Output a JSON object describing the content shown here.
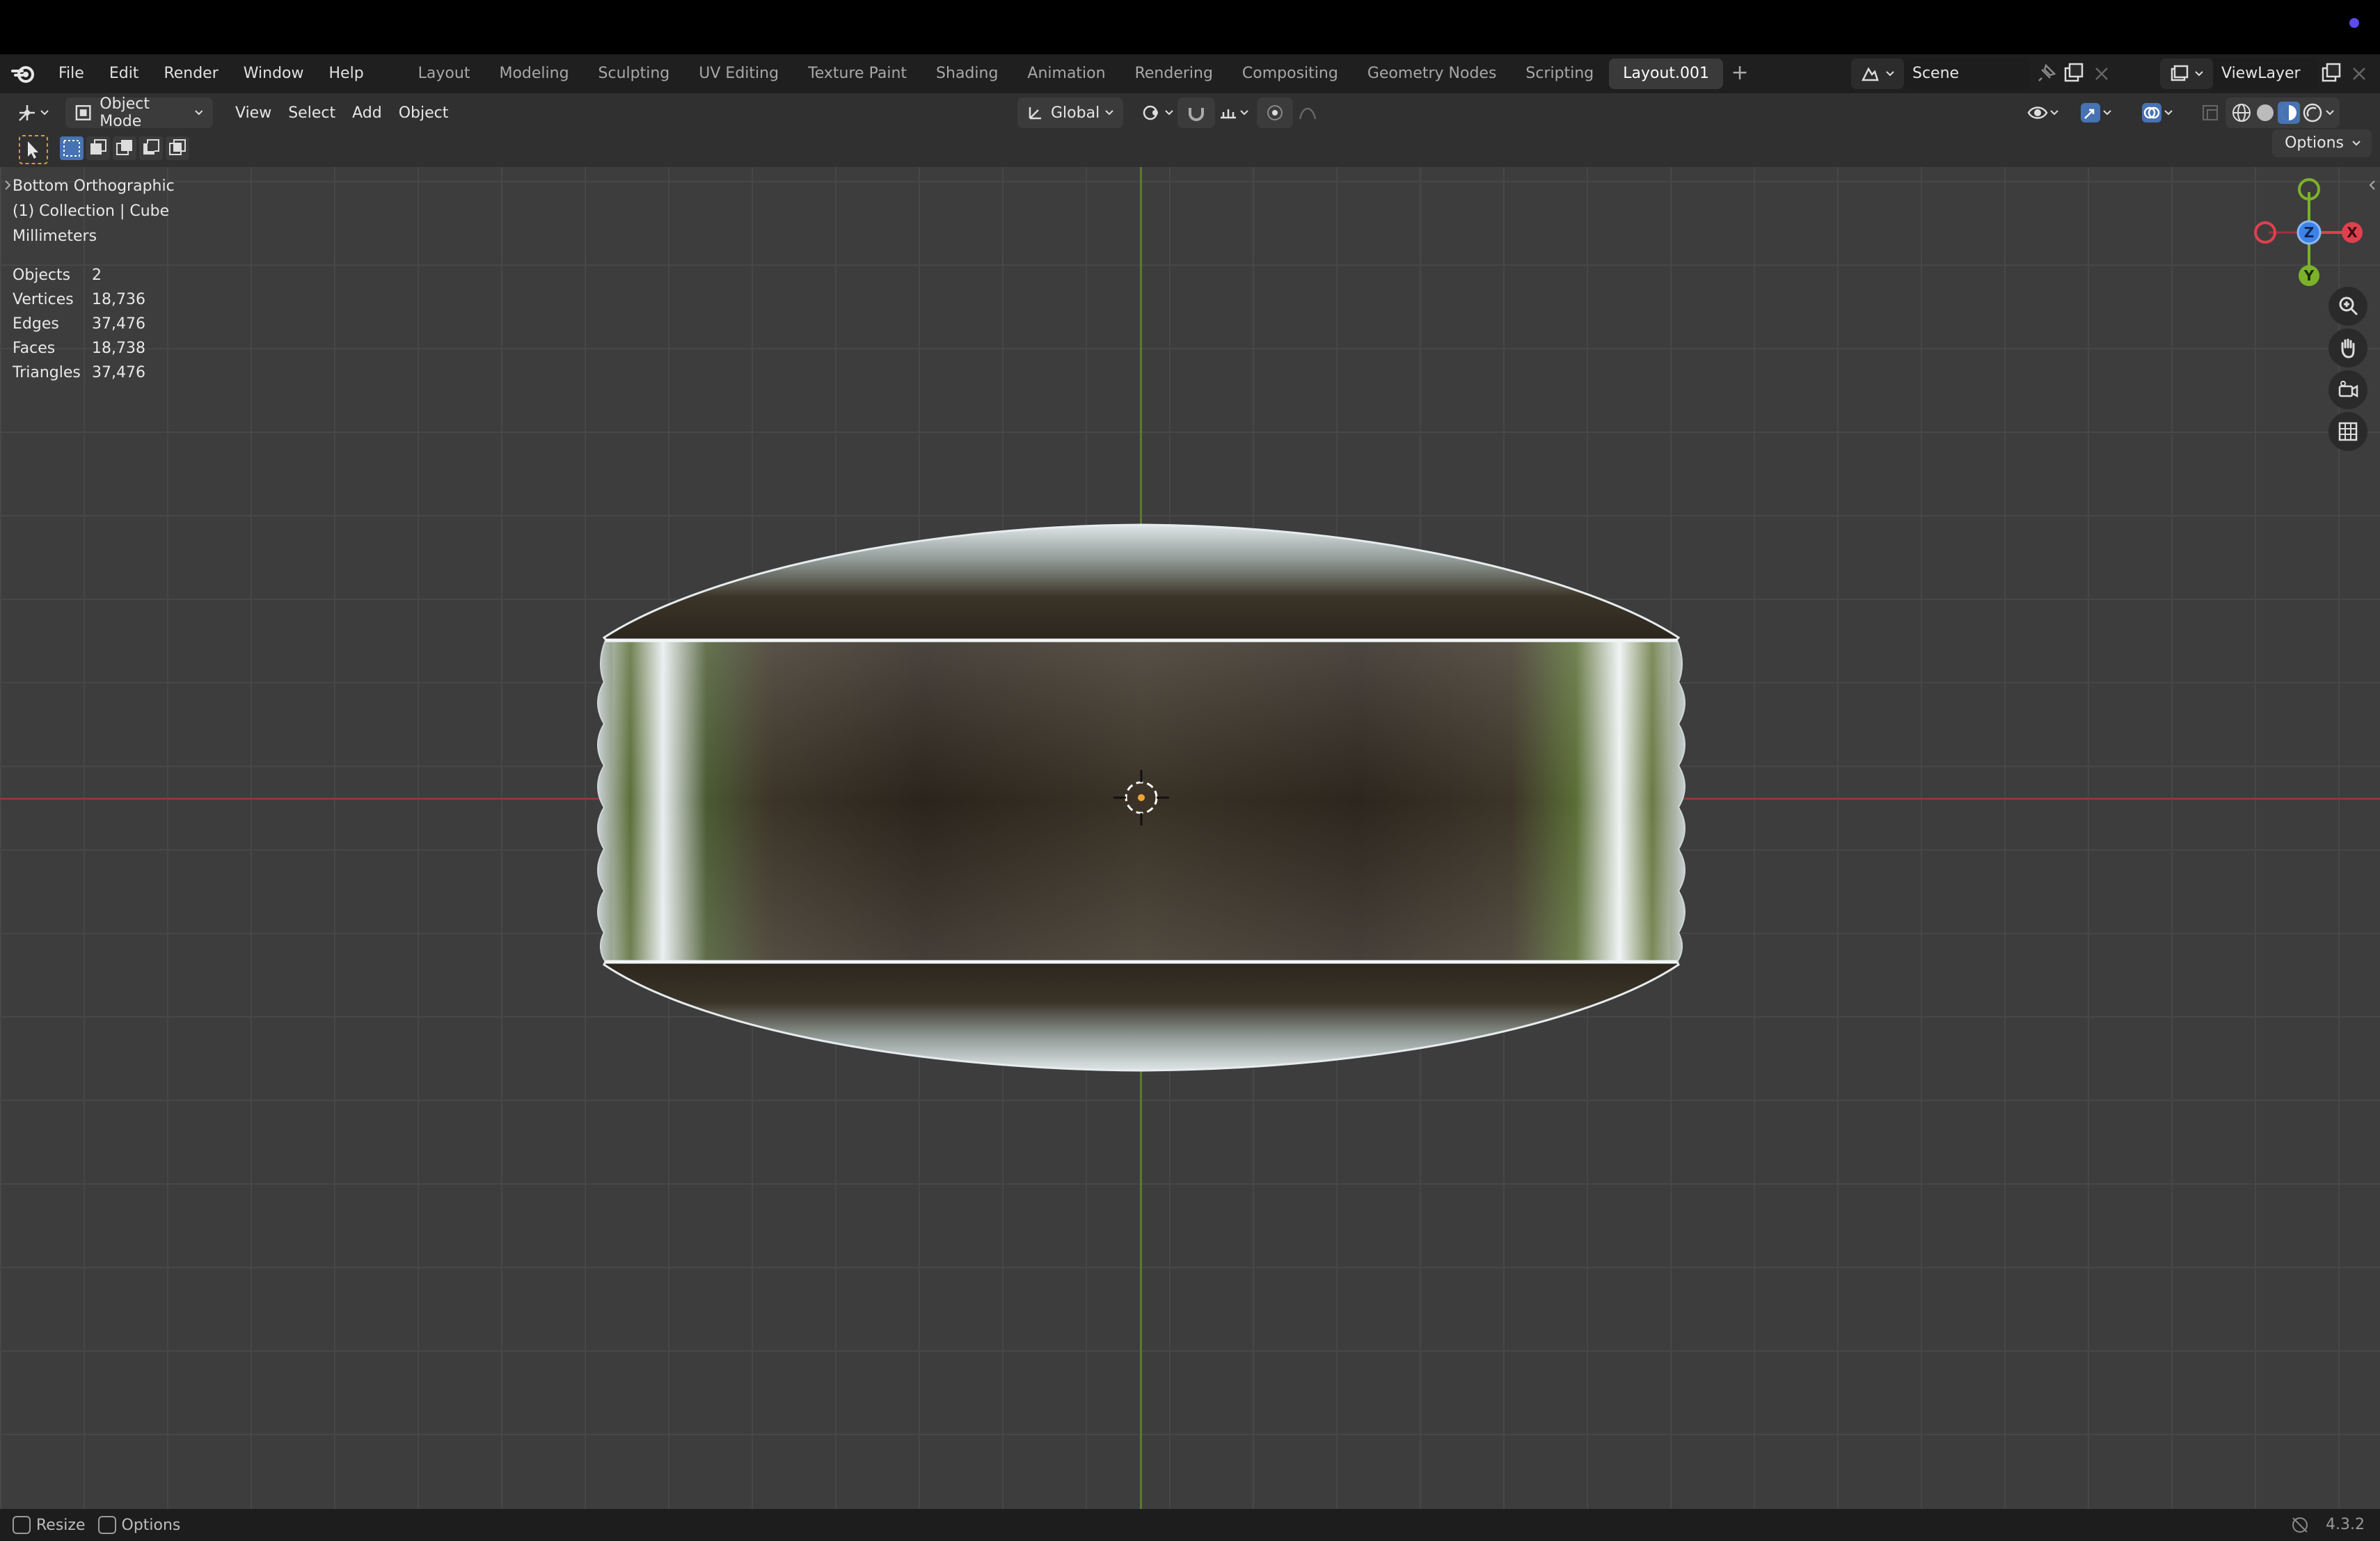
{
  "app": {
    "version": "4.3.2"
  },
  "menu": {
    "items": [
      "File",
      "Edit",
      "Render",
      "Window",
      "Help"
    ]
  },
  "workspaces": {
    "tabs": [
      "Layout",
      "Modeling",
      "Sculpting",
      "UV Editing",
      "Texture Paint",
      "Shading",
      "Animation",
      "Rendering",
      "Compositing",
      "Geometry Nodes",
      "Scripting",
      "Layout.001"
    ],
    "active": "Layout.001",
    "add_label": "+"
  },
  "scene": {
    "name": "Scene"
  },
  "view_layer": {
    "name": "ViewLayer"
  },
  "header": {
    "mode": "Object Mode",
    "view": "View",
    "select": "Select",
    "add": "Add",
    "object": "Object",
    "orientation": "Global"
  },
  "toolbar": {
    "options_label": "Options"
  },
  "viewport": {
    "view_name": "Bottom Orthographic",
    "collection": "(1) Collection | Cube",
    "units": "Millimeters",
    "stats": [
      {
        "label": "Objects",
        "value": "2"
      },
      {
        "label": "Vertices",
        "value": "18,736"
      },
      {
        "label": "Edges",
        "value": "37,476"
      },
      {
        "label": "Faces",
        "value": "18,738"
      },
      {
        "label": "Triangles",
        "value": "37,476"
      }
    ],
    "gizmo": {
      "x": "X",
      "y": "Y",
      "z": "Z"
    }
  },
  "statusbar": {
    "resize": "Resize",
    "options": "Options"
  },
  "colors": {
    "x_axis": "#e0404e",
    "y_axis": "#7bb22a",
    "z_axis": "#3c82e8",
    "accent": "#4772b3"
  }
}
